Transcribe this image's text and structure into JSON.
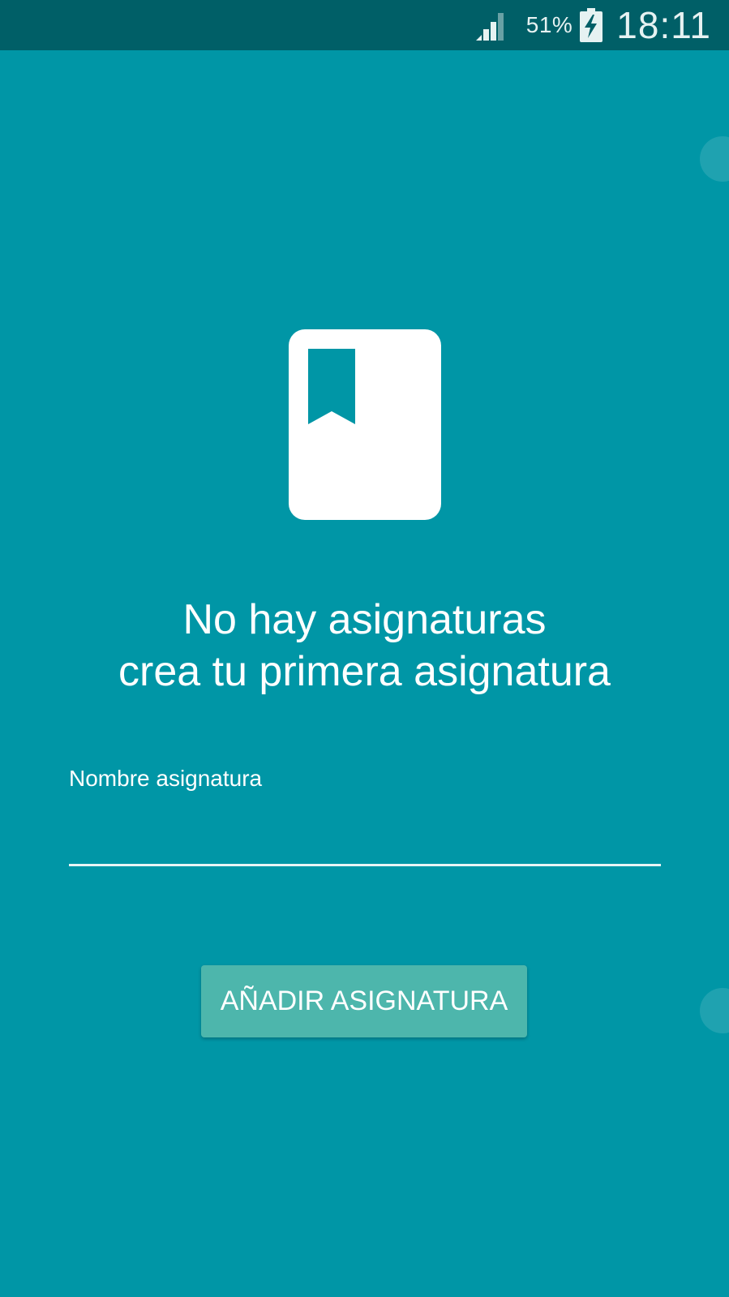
{
  "status_bar": {
    "battery_percent": "51%",
    "time": "18:11",
    "icons": [
      "signal-icon",
      "battery-charging-icon"
    ]
  },
  "empty_state": {
    "icon": "book-bookmark-icon",
    "line1": "No hay asignaturas",
    "line2": "crea tu primera asignatura"
  },
  "form": {
    "name_label": "Nombre asignatura",
    "name_value": "",
    "add_button_label": "AÑADIR ASIGNATURA"
  },
  "colors": {
    "background": "#0096a6",
    "status_bar": "#005f67",
    "button": "#4db6ac",
    "text": "#ffffff"
  }
}
